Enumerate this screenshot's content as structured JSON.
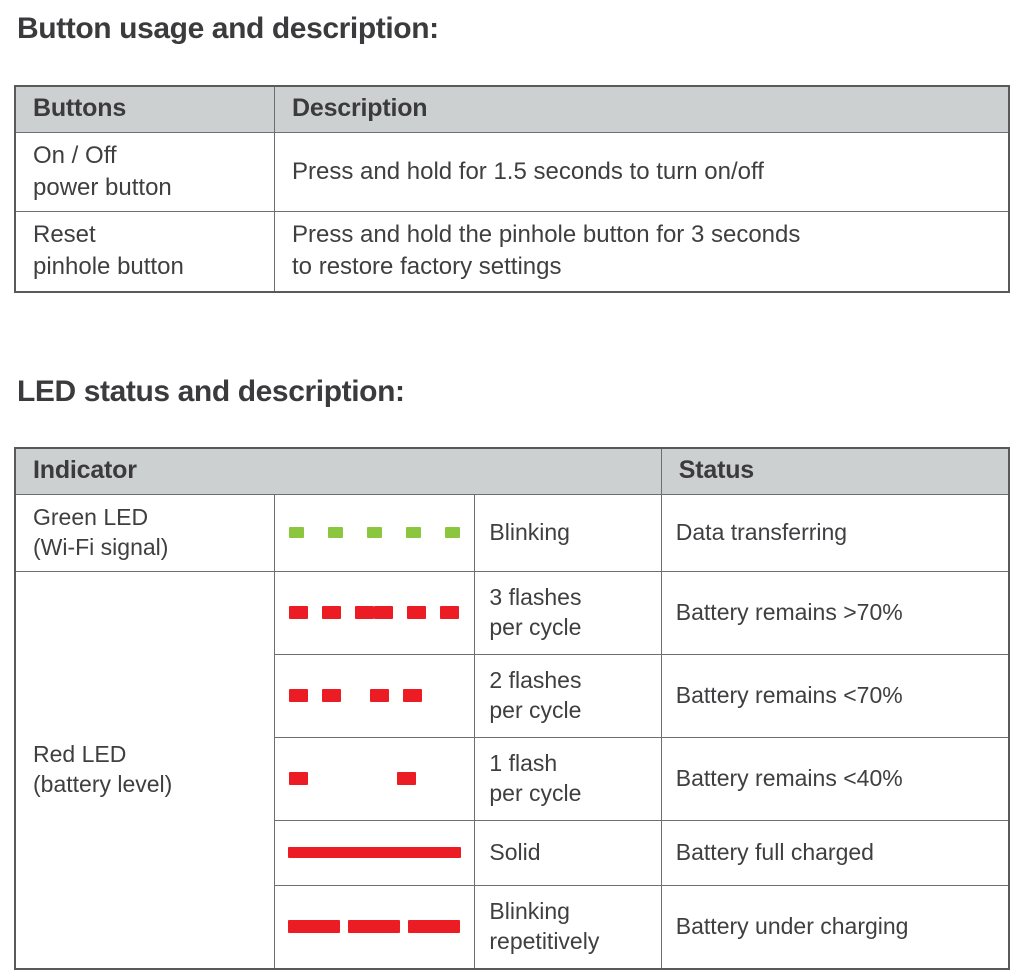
{
  "document": {
    "sections": [
      {
        "heading": "Button usage and description:",
        "table": {
          "columns": [
            "Buttons",
            "Description"
          ],
          "rows": [
            {
              "button": "On / Off\npower button",
              "description": "Press and hold for 1.5 seconds to turn on/off"
            },
            {
              "button": "Reset\npinhole button",
              "description": "Press and hold the pinhole button for 3 seconds\nto restore factory settings"
            }
          ]
        }
      },
      {
        "heading": "LED status and description:",
        "table": {
          "columns": [
            "Indicator",
            "Status"
          ],
          "rows": [
            {
              "indicator": "Green LED\n(Wi-Fi signal)",
              "pattern": "green-blink-5-dashes",
              "pattern_color": "#8cc63e",
              "behavior": "Blinking",
              "status": "Data transferring"
            },
            {
              "indicator": "Red LED\n(battery level)",
              "pattern": "red-3-flashes-two-groups",
              "pattern_color": "#ec1c24",
              "behavior": "3 flashes\nper cycle",
              "status": "Battery remains >70%"
            },
            {
              "indicator": "",
              "pattern": "red-2-flashes-two-groups",
              "pattern_color": "#ec1c24",
              "behavior": "2 flashes\nper cycle",
              "status": "Battery remains <70%"
            },
            {
              "indicator": "",
              "pattern": "red-1-flash-two-groups",
              "pattern_color": "#ec1c24",
              "behavior": "1 flash\nper cycle",
              "status": "Battery remains <40%"
            },
            {
              "indicator": "",
              "pattern": "red-solid-bar",
              "pattern_color": "#ec1c24",
              "behavior": "Solid",
              "status": "Battery full charged"
            },
            {
              "indicator": "",
              "pattern": "red-3-long-dashes",
              "pattern_color": "#ec1c24",
              "behavior": "Blinking\nrepetitively",
              "status": "Battery under charging"
            }
          ]
        }
      }
    ]
  },
  "colors": {
    "header_background": "#cdd0d1",
    "border": "#58595b",
    "inner_border": "#6d6e70",
    "text": "#3f3f41",
    "green_led": "#8cc63e",
    "red_led": "#ec1c24"
  }
}
